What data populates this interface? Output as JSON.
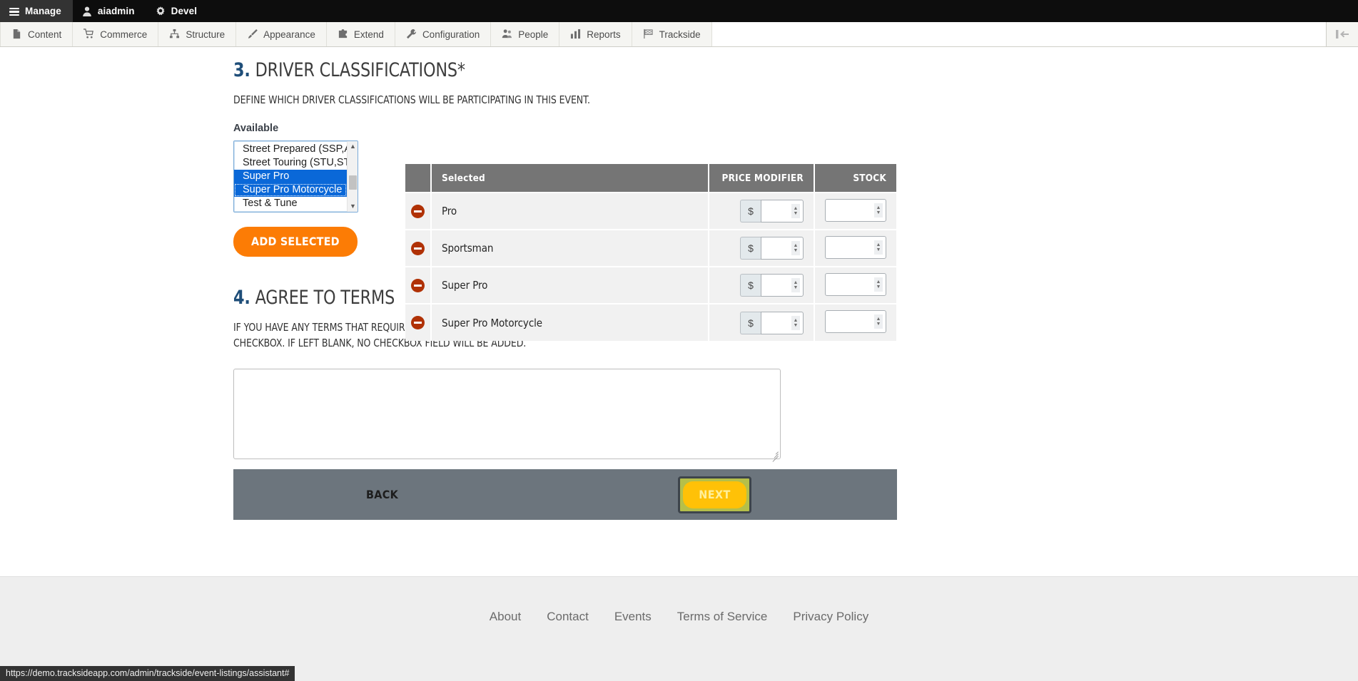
{
  "toolbar": {
    "tabs": [
      {
        "label": "Manage",
        "icon": "hamburger-icon",
        "active": true
      },
      {
        "label": "aiadmin",
        "icon": "user-icon",
        "active": false
      },
      {
        "label": "Devel",
        "icon": "gear-icon",
        "active": false
      }
    ],
    "tray_items": [
      {
        "label": "Content",
        "icon": "document-icon"
      },
      {
        "label": "Commerce",
        "icon": "shopping-cart-icon"
      },
      {
        "label": "Structure",
        "icon": "sitemap-icon"
      },
      {
        "label": "Appearance",
        "icon": "paintbrush-icon"
      },
      {
        "label": "Extend",
        "icon": "puzzle-piece-icon"
      },
      {
        "label": "Configuration",
        "icon": "wrench-icon"
      },
      {
        "label": "People",
        "icon": "people-icon"
      },
      {
        "label": "Reports",
        "icon": "bar-chart-icon"
      },
      {
        "label": "Trackside",
        "icon": "checkered-flag-icon"
      }
    ],
    "toggle_icon": "collapse-tray-icon"
  },
  "section3": {
    "number": "3.",
    "title": "DRIVER CLASSIFICATIONS*",
    "description": "DEFINE WHICH DRIVER CLASSIFICATIONS WILL BE PARTICIPATING IN THIS EVENT.",
    "available_label": "Available",
    "available_options": [
      {
        "label": "Street Prepared (SSP,ASP",
        "selected": false
      },
      {
        "label": "Street Touring (STU,STR,S",
        "selected": false
      },
      {
        "label": "Super Pro",
        "selected": true,
        "focused": false
      },
      {
        "label": "Super Pro Motorcycle",
        "selected": true,
        "focused": true
      },
      {
        "label": "Test & Tune",
        "selected": false
      }
    ],
    "add_selected_label": "ADD SELECTED",
    "table": {
      "headers": {
        "blank": "",
        "selected": "Selected",
        "price_modifier": "PRICE MODIFIER",
        "stock": "STOCK"
      },
      "currency_symbol": "$",
      "rows": [
        {
          "name": "Pro",
          "price_modifier": "",
          "stock": ""
        },
        {
          "name": "Sportsman",
          "price_modifier": "",
          "stock": ""
        },
        {
          "name": "Super Pro",
          "price_modifier": "",
          "stock": ""
        },
        {
          "name": "Super Pro Motorcycle",
          "price_modifier": "",
          "stock": ""
        }
      ]
    }
  },
  "section4": {
    "number": "4.",
    "title": "AGREE TO TERMS",
    "description": "IF YOU HAVE ANY TERMS THAT REQUIRE AGREEMENT, ADD THEM HERE. THIS WILL APPEAR ON THE REGISTRATION FORM AS A REQUIRED CHECKBOX. IF LEFT BLANK, NO CHECKBOX FIELD WILL BE ADDED.",
    "terms_value": "",
    "terms_placeholder": ""
  },
  "wizard_nav": {
    "back_label": "BACK",
    "next_label": "NEXT"
  },
  "footer": {
    "links": [
      {
        "label": "About"
      },
      {
        "label": "Contact"
      },
      {
        "label": "Events"
      },
      {
        "label": "Terms of Service"
      },
      {
        "label": "Privacy Policy"
      }
    ]
  },
  "status_bar": {
    "url": "https://demo.tracksideapp.com/admin/trackside/event-listings/assistant#"
  },
  "colors": {
    "accent_orange": "#fc7c05",
    "next_amber": "#ffc107",
    "focus_olive": "#b5bf4a",
    "table_header_gray": "#757575",
    "nav_bar_gray": "#6c757d",
    "section_number_blue": "#1f4e79",
    "remove_red": "#b03105",
    "select_highlight_blue": "#0a68d8"
  }
}
